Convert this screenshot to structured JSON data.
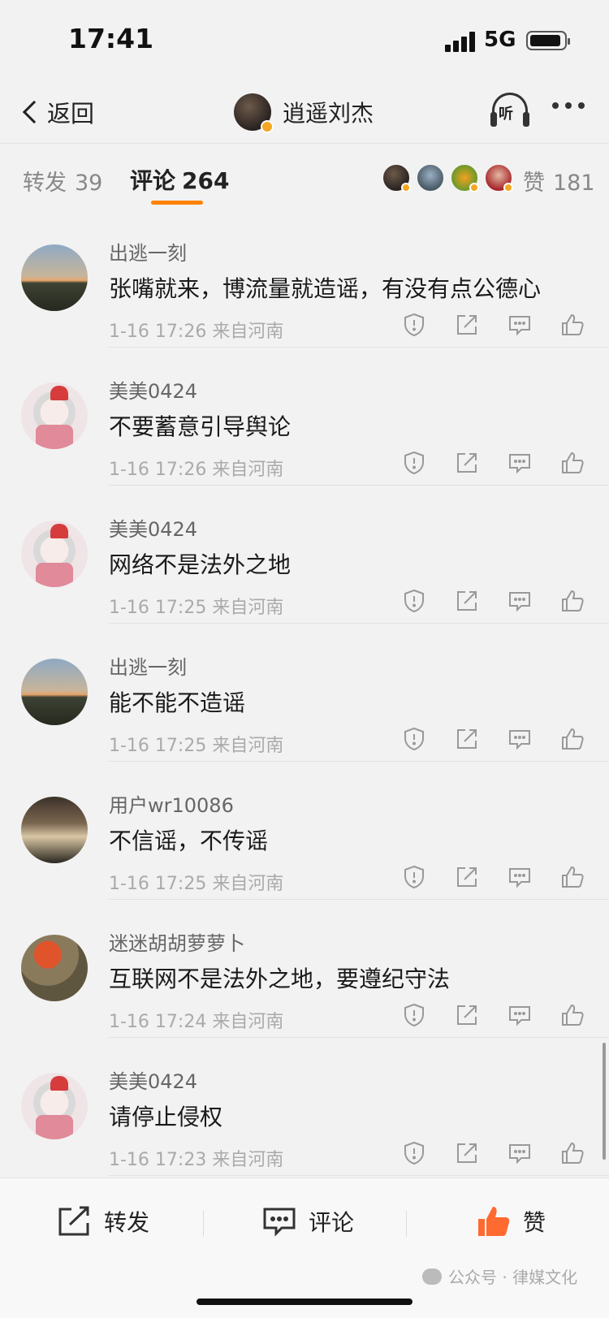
{
  "status_bar": {
    "time": "17:41",
    "network": "5G"
  },
  "nav": {
    "back_label": "返回",
    "username": "逍遥刘杰",
    "listen_label": "听"
  },
  "tabs": {
    "repost_label": "转发",
    "repost_count": "39",
    "comment_label": "评论",
    "comment_count": "264",
    "like_label": "赞",
    "like_count": "181"
  },
  "colors": {
    "accent": "#ff8200",
    "verified_badge": "#f5a623",
    "like_active": "#ff6a30"
  },
  "comments": [
    {
      "user": "出逃一刻",
      "text": "张嘴就来，博流量就造谣，有没有点公德心",
      "meta": "1-16 17:26  来自河南",
      "avatar": "sunset"
    },
    {
      "user": "美美0424",
      "text": "不要蓄意引导舆论",
      "meta": "1-16 17:26  来自河南",
      "avatar": "girl"
    },
    {
      "user": "美美0424",
      "text": "网络不是法外之地",
      "meta": "1-16 17:25  来自河南",
      "avatar": "girl"
    },
    {
      "user": "出逃一刻",
      "text": "能不能不造谣",
      "meta": "1-16 17:25  来自河南",
      "avatar": "sunset"
    },
    {
      "user": "用户wr10086",
      "text": "不信谣，不传谣",
      "meta": "1-16 17:25  来自河南",
      "avatar": "cat"
    },
    {
      "user": "迷迷胡胡萝萝卜",
      "text": "互联网不是法外之地，要遵纪守法",
      "meta": "1-16 17:24  来自河南",
      "avatar": "red"
    },
    {
      "user": "美美0424",
      "text": "请停止侵权",
      "meta": "1-16 17:23  来自河南",
      "avatar": "girl"
    }
  ],
  "bottom_bar": {
    "repost_label": "转发",
    "comment_label": "评论",
    "like_label": "赞"
  },
  "watermark": "公众号 · 律媒文化"
}
